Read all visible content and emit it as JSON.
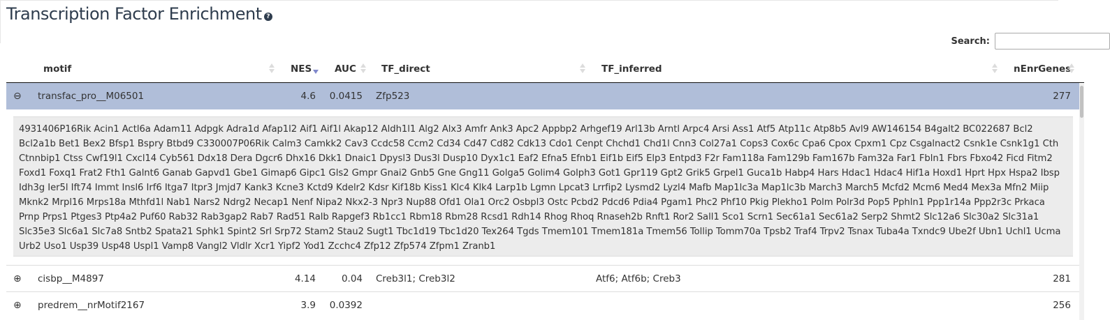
{
  "page": {
    "title": "Transcription Factor Enrichment",
    "help_icon": "?"
  },
  "search": {
    "label": "Search:",
    "value": "",
    "placeholder": ""
  },
  "table": {
    "columns": [
      "motif",
      "NES",
      "AUC",
      "TF_direct",
      "TF_inferred",
      "nEnrGenes"
    ],
    "sort": {
      "column": "NES",
      "direction": "descending"
    },
    "rows": [
      {
        "control": "⊖",
        "motif": "transfac_pro__M06501",
        "NES": "4.6",
        "AUC": "0.0415",
        "TF_direct": "Zfp523",
        "TF_inferred": "",
        "nEnrGenes": "277",
        "expanded": true,
        "detail": "4931406P16Rik Acin1 Actl6a Adam11 Adpgk Adra1d Afap1l2 Aif1 Aif1l Akap12 Aldh1l1 Alg2 Alx3 Amfr Ank3 Apc2 Appbp2 Arhgef19 Arl13b Arntl Arpc4 Arsi Ass1 Atf5 Atp11c Atp8b5 Avl9 AW146154 B4galt2 BC022687 Bcl2 Bcl2a1b Bet1 Bex2 Bfsp1 Bspry Btbd9 C330007P06Rik Calm3 Camkk2 Cav3 Ccdc58 Ccm2 Cd34 Cd47 Cd82 Cdk13 Cdo1 Cenpt Chchd1 Chd1l Cnn3 Col27a1 Cops3 Cox6c Cpa6 Cpox Cpxm1 Cpz Csgalnact2 Csnk1e Csnk1g1 Cth Ctnnbip1 Ctss Cwf19l1 Cxcl14 Cyb561 Ddx18 Dera Dgcr6 Dhx16 Dkk1 Dnaic1 Dpysl3 Dus3l Dusp10 Dyx1c1 Eaf2 Efna5 Efnb1 Eif1b Eif5 Elp3 Entpd3 F2r Fam118a Fam129b Fam167b Fam32a Far1 Fbln1 Fbrs Fbxo42 Ficd Fitm2 Foxd1 Foxq1 Frat2 Fth1 Galnt6 Ganab Gapvd1 Gbe1 Gimap6 Gipc1 Gls2 Gmpr Gnai2 Gnb5 Gne Gng11 Golga5 Golim4 Golph3 Got1 Gpr119 Gpt2 Grik5 Grpel1 Guca1b Habp4 Hars Hdac1 Hdac4 Hif1a Hoxd1 Hprt Hpx Hspa2 Ibsp Idh3g Ier5l Ift74 Immt Insl6 Irf6 Itga7 Itpr3 Jmjd7 Kank3 Kcne3 Kctd9 Kdelr2 Kdsr Kif18b Kiss1 Klc4 Klk4 Larp1b Lgmn Lpcat3 Lrrfip2 Lysmd2 Lyzl4 Mafb Map1lc3a Map1lc3b March3 March5 Mcfd2 Mcm6 Med4 Mex3a Mfn2 Miip Mknk2 Mrpl16 Mrps18a Mthfd1l Nab1 Nars2 Ndrg2 Necap1 Nenf Nipa2 Nkx2-3 Npr3 Nup88 Ofd1 Ola1 Orc2 Osbpl3 Ostc Pcbd2 Pdcd6 Pdia4 Pgam1 Phc2 Phf10 Pkig Plekho1 Polm Polr3d Pop5 Pphln1 Ppp1r14a Ppp2r3c Prkaca Prnp Prps1 Ptges3 Ptp4a2 Puf60 Rab32 Rab3gap2 Rab7 Rad51 Ralb Rapgef3 Rb1cc1 Rbm18 Rbm28 Rcsd1 Rdh14 Rhog Rhoq Rnaseh2b Rnft1 Ror2 Sall1 Sco1 Scrn1 Sec61a1 Sec61a2 Serp2 Shmt2 Slc12a6 Slc30a2 Slc31a1 Slc35e3 Slc6a1 Slc7a8 Sntb2 Spata21 Sphk1 Spint2 Srl Srp72 Stam2 Stau2 Sugt1 Tbc1d19 Tbc1d20 Tex264 Tgds Tmem101 Tmem181a Tmem56 Tollip Tomm70a Tpsb2 Traf4 Trpv2 Tsnax Tuba4a Txndc9 Ube2f Ubn1 Uchl1 Ucma Urb2 Uso1 Usp39 Usp48 Uspl1 Vamp8 Vangl2 Vldlr Xcr1 Yipf2 Yod1 Zcchc4 Zfp12 Zfp574 Zfpm1 Zranb1"
      },
      {
        "control": "⊕",
        "motif": "cisbp__M4897",
        "NES": "4.14",
        "AUC": "0.04",
        "TF_direct": "Creb3l1; Creb3l2",
        "TF_inferred": "Atf6; Atf6b; Creb3",
        "nEnrGenes": "281",
        "expanded": false
      },
      {
        "control": "⊕",
        "motif": "predrem__nrMotif2167",
        "NES": "3.9",
        "AUC": "0.0392",
        "TF_direct": "",
        "TF_inferred": "",
        "nEnrGenes": "256",
        "expanded": false
      }
    ]
  }
}
